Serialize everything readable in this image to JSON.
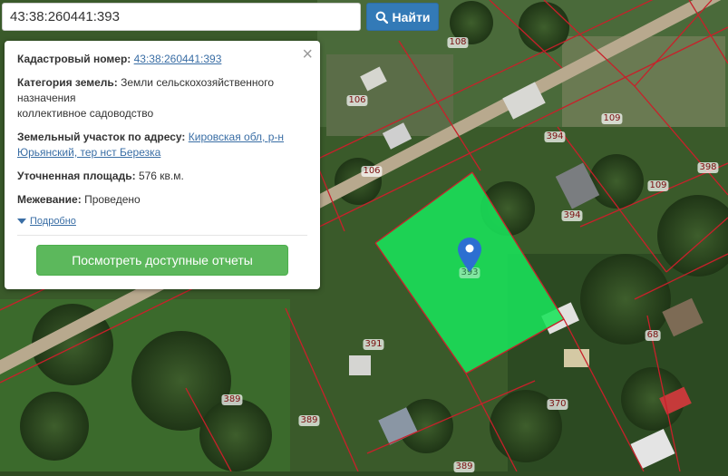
{
  "search": {
    "value": "43:38:260441:393"
  },
  "find_button": {
    "label": "Найти",
    "color": "#337ab7"
  },
  "popup": {
    "cadastral_label": "Кадастровый номер:",
    "cadastral_value": "43:38:260441:393",
    "category_label": "Категория земель:",
    "category_value": "Земли сельскохозяйственного назначения",
    "usage_value": "коллективное садоводство",
    "address_label": "Земельный участок по адресу:",
    "address_value": "Кировская обл, р-н Юрьянский, тер нст Березка",
    "area_label": "Уточненная площадь:",
    "area_value": "576 кв.м.",
    "survey_label": "Межевание:",
    "survey_value": "Проведено",
    "more_link": "Подробно",
    "report_button": "Посмотреть доступные отчеты",
    "report_button_color": "#5cb85c",
    "close_icon": "close-icon"
  },
  "map": {
    "selected_parcel_color": "#19e35a",
    "boundary_color": "#c8202a",
    "marker_color": "#2c6fd1",
    "parcel_labels": [
      "108",
      "106",
      "106",
      "394",
      "109",
      "398",
      "109",
      "394",
      "391",
      "68",
      "389",
      "389",
      "370",
      "389"
    ],
    "selected_parcel_label": "393"
  }
}
